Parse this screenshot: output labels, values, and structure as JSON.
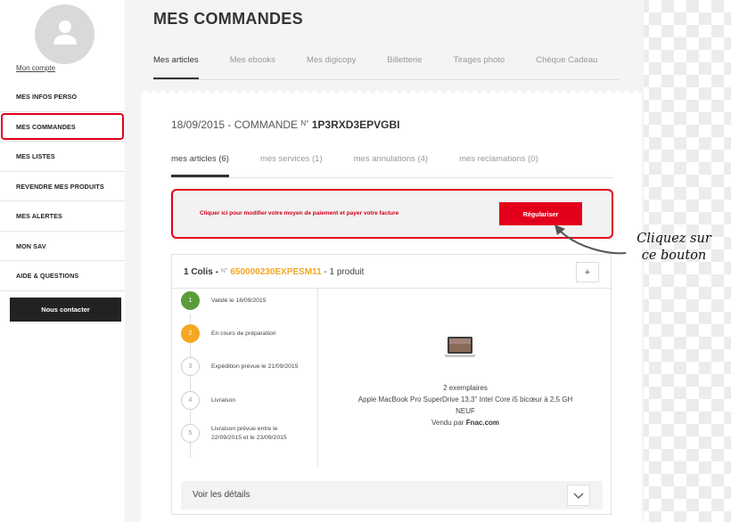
{
  "sidebar": {
    "account_link": "Mon compte",
    "items": [
      {
        "label": "MES INFOS PERSO"
      },
      {
        "label": "MES COMMANDES"
      },
      {
        "label": "MES LISTES"
      },
      {
        "label": "REVENDRE MES PRODUITS"
      },
      {
        "label": "MES ALERTES"
      },
      {
        "label": "MON SAV"
      },
      {
        "label": "AIDE & QUESTIONS"
      }
    ],
    "contact_button": "Nous contacter"
  },
  "main": {
    "title": "MES COMMANDES",
    "tabs": [
      {
        "label": "Mes articles"
      },
      {
        "label": "Mes ebooks"
      },
      {
        "label": "Mes digicopy"
      },
      {
        "label": "Billetterie"
      },
      {
        "label": "Tirages photo"
      },
      {
        "label": "Chèque Cadeau"
      }
    ]
  },
  "order": {
    "date_prefix": "18/09/2015 - COMMANDE",
    "number_symbol": "N°",
    "number": "1P3RXD3EPVGBI",
    "subtabs": [
      {
        "label": "mes articles (6)"
      },
      {
        "label": "mes services (1)"
      },
      {
        "label": "mes annulations (4)"
      },
      {
        "label": "mes reclamations (0)"
      }
    ],
    "payment": {
      "message": "Cliquer ici pour modifier votre moyen de paiement et payer votre facture",
      "button": "Régulariser"
    },
    "package": {
      "title": "1 Colis -",
      "symbol": "N°",
      "reference": "650000230EXPESM11",
      "count": "- 1 produit",
      "expand": "+",
      "steps": [
        {
          "num": "1",
          "label": "Validé le 18/09/2015"
        },
        {
          "num": "2",
          "label": "En cours de préparation"
        },
        {
          "num": "3",
          "label": "Expédition prévue le 21/09/2015"
        },
        {
          "num": "4",
          "label": "Livraison"
        },
        {
          "num": "5",
          "label": "Livraison prévue entre le 22/09/2015 et le 23/09/2015"
        }
      ],
      "product": {
        "quantity": "2 exemplaires",
        "name": "Apple MacBook Pro SuperDrive 13,3'' Intel Core i5 bicœur à 2,5 GH",
        "condition": "NEUF",
        "vendor_prefix": "Vendu par",
        "vendor": "Fnac.com"
      },
      "details": "Voir les détails"
    }
  },
  "annotation": {
    "line1": "Cliquez sur",
    "line2": "ce bouton"
  },
  "colors": {
    "accent": "#e3001b",
    "done": "#5a9c3a",
    "current": "#f5a623"
  }
}
